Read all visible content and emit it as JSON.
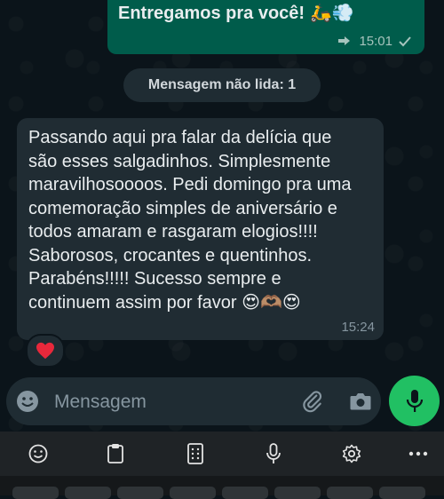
{
  "outgoing": {
    "text": "Entregamos pra você! 🛵💨",
    "time": "15:01"
  },
  "unread_divider": "Mensagem não lida: 1",
  "incoming": {
    "text": "Passando aqui pra falar da delícia que\nsão esses salgadinhos. Simplesmente\nmaravilhosoooos. Pedi domingo pra uma\ncomemoração simples de aniversário e\ntodos amaram e rasgaram elogios!!!!\nSaborosos, crocantes e quentinhos.\nParabéns!!!!! Sucesso sempre e\ncontinuem assim por favor 😍🫶🏽😍",
    "time": "15:24",
    "reaction": "❤️"
  },
  "composer": {
    "placeholder": "Mensagem"
  },
  "colors": {
    "background": "#0b141a",
    "outgoing_bubble": "#005c4b",
    "incoming_bubble": "#202c33",
    "accent_green": "#21c063",
    "text": "#e9edef",
    "muted": "#8696a0"
  },
  "icons": {
    "composer": [
      "emoji-icon",
      "attach-icon",
      "camera-icon",
      "mic-icon"
    ],
    "keyboard_toolbar": [
      "emoji-icon",
      "clipboard-icon",
      "keypad-icon",
      "voice-input-icon",
      "settings-icon",
      "more-icon"
    ]
  }
}
